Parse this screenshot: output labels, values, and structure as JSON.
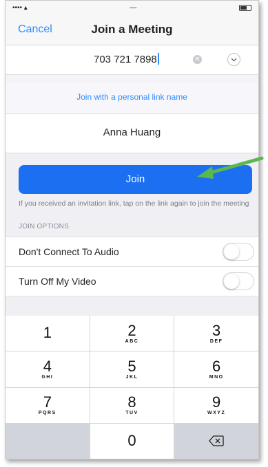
{
  "navbar": {
    "cancel": "Cancel",
    "title": "Join a Meeting"
  },
  "meeting": {
    "id": "703 721 7898"
  },
  "link_option": "Join with a personal link name",
  "name": "Anna Huang",
  "join_button": "Join",
  "hint": "If you received an invitation link, tap on the link again to join the meeting",
  "options": {
    "header": "JOIN OPTIONS",
    "items": [
      {
        "label": "Don't Connect To Audio",
        "on": false
      },
      {
        "label": "Turn Off My Video",
        "on": false
      }
    ]
  },
  "keypad": {
    "keys": [
      {
        "num": "1",
        "letters": ""
      },
      {
        "num": "2",
        "letters": "ABC"
      },
      {
        "num": "3",
        "letters": "DEF"
      },
      {
        "num": "4",
        "letters": "GHI"
      },
      {
        "num": "5",
        "letters": "JKL"
      },
      {
        "num": "6",
        "letters": "MNO"
      },
      {
        "num": "7",
        "letters": "PQRS"
      },
      {
        "num": "8",
        "letters": "TUV"
      },
      {
        "num": "9",
        "letters": "WXYZ"
      },
      {
        "num": "0",
        "letters": ""
      }
    ]
  },
  "colors": {
    "accent": "#2d8cff",
    "join": "#1d6ff2",
    "arrow": "#5ab84f"
  }
}
